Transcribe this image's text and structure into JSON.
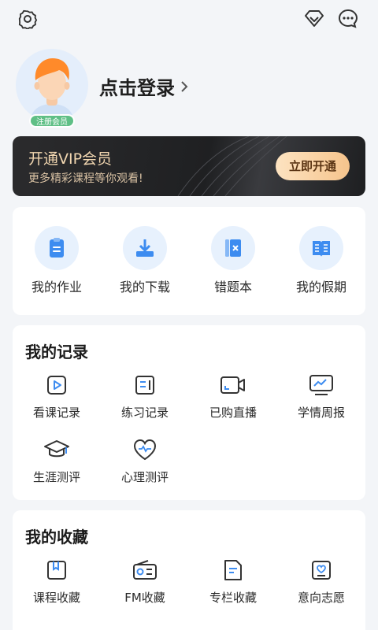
{
  "top_icons": [
    "settings-icon",
    "diamond-icon",
    "message-icon"
  ],
  "profile": {
    "login_text": "点击登录",
    "badge": "注册会员"
  },
  "vip": {
    "title": "开通VIP会员",
    "subtitle": "更多精彩课程等你观看!",
    "button": "立即开通"
  },
  "quick": [
    {
      "label": "我的作业",
      "icon": "clipboard-icon"
    },
    {
      "label": "我的下载",
      "icon": "download-icon"
    },
    {
      "label": "错题本",
      "icon": "wrong-book-icon"
    },
    {
      "label": "我的假期",
      "icon": "holiday-book-icon"
    }
  ],
  "records": {
    "title": "我的记录",
    "items": [
      {
        "label": "看课记录",
        "icon": "play-video-icon"
      },
      {
        "label": "练习记录",
        "icon": "practice-icon"
      },
      {
        "label": "已购直播",
        "icon": "camera-icon"
      },
      {
        "label": "学情周报",
        "icon": "report-icon"
      },
      {
        "label": "生涯测评",
        "icon": "graduation-cap-icon"
      },
      {
        "label": "心理测评",
        "icon": "heart-pulse-icon"
      }
    ]
  },
  "favorites": {
    "title": "我的收藏",
    "items": [
      {
        "label": "课程收藏",
        "icon": "bookmark-icon"
      },
      {
        "label": "FM收藏",
        "icon": "radio-icon"
      },
      {
        "label": "专栏收藏",
        "icon": "column-icon"
      },
      {
        "label": "意向志愿",
        "icon": "heart-card-icon"
      }
    ]
  },
  "colors": {
    "accent": "#3d8cf0",
    "icon_bg": "#e7f1fd",
    "vip_gold": "#f1d6b0",
    "badge_green": "#5fbf86"
  }
}
